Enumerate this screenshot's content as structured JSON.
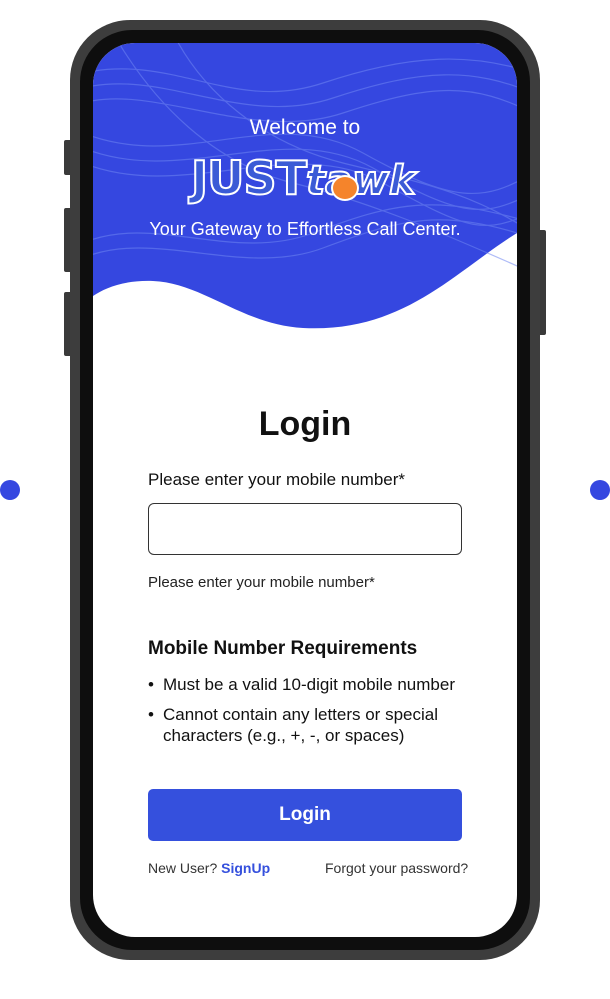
{
  "colors": {
    "brand_blue": "#3550dd",
    "hero_blue": "#3547e0",
    "accent_orange": "#f5842b"
  },
  "hero": {
    "welcome_text": "Welcome to",
    "logo": {
      "part1": "JUST",
      "part2": "tawk"
    },
    "tagline": "Your Gateway to Effortless Call Center."
  },
  "login_form": {
    "title": "Login",
    "mobile_label": "Please enter your mobile number*",
    "mobile_value": "",
    "helper_text": "Please enter your mobile number*",
    "requirements_heading": "Mobile Number Requirements",
    "requirements": [
      "Must be a valid 10-digit mobile number",
      "Cannot contain any letters or special characters (e.g., +, -, or spaces)"
    ],
    "login_button_label": "Login"
  },
  "footer": {
    "new_user_text": "New User?",
    "signup_label": "SignUp",
    "forgot_password_label": "Forgot your password?"
  }
}
